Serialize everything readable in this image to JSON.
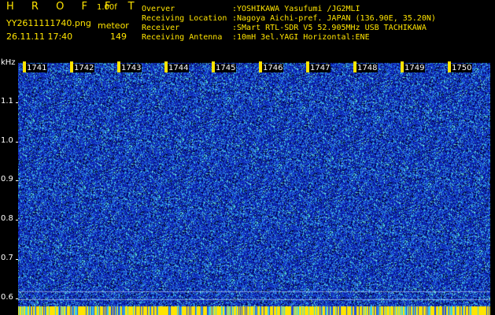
{
  "header": {
    "app_title": "H R O F F T",
    "version": "1.00f",
    "filename": "YY2611111740.png",
    "mode": "meteor",
    "datetime": "26.11.11 17:40",
    "count": "149"
  },
  "info": [
    {
      "label": "Overver",
      "value": ":YOSHIKAWA Yasufumi /JG2MLI"
    },
    {
      "label": "Receiving Location",
      "value": ":Nagoya Aichi-pref. JAPAN (136.90E, 35.20N)"
    },
    {
      "label": "Receiver",
      "value": ":SMart RTL-SDR V5 52.905MHz USB TACHIKAWA"
    },
    {
      "label": "Receiving Antenna",
      "value": ":10mH 3el.YAGI Horizontal:ENE"
    }
  ],
  "axis": {
    "unit": "kHz",
    "y_ticks": [
      "1.1",
      "1.0",
      "0.9",
      "0.8",
      "0.7",
      "0.6"
    ],
    "minute_labels": [
      "1741",
      "1742",
      "1743",
      "1744",
      "1745",
      "1746",
      "1747",
      "1748",
      "1749",
      "1750"
    ]
  },
  "colors": {
    "background": "#000000",
    "accent": "#ffe400",
    "noise_dark": "#0a1a8c",
    "noise_mid": "#1f4fe0",
    "noise_bright": "#3fd0e8"
  }
}
